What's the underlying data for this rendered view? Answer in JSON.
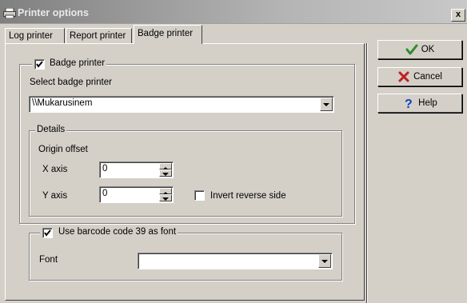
{
  "window": {
    "title": "Printer options",
    "close_label": "x"
  },
  "tabs": [
    {
      "label": "Log printer"
    },
    {
      "label": "Report printer"
    },
    {
      "label": "Badge printer",
      "active": true
    }
  ],
  "badge_section": {
    "checkbox_label": "Badge printer",
    "checked": true,
    "select_label": "Select badge printer",
    "selected_printer": "\\\\Mukarusinem"
  },
  "details": {
    "title": "Details",
    "origin_label": "Origin offset",
    "x_label": "X axis",
    "x_value": "0",
    "y_label": "Y axis",
    "y_value": "0",
    "invert_label": "Invert reverse side",
    "invert_checked": false
  },
  "barcode": {
    "checkbox_label": "Use barcode code 39 as font",
    "checked": true,
    "font_label": "Font",
    "font_value": ""
  },
  "buttons": {
    "ok": "OK",
    "cancel": "Cancel",
    "help": "Help"
  },
  "colors": {
    "ok_icon": "#2e8b2e",
    "cancel_icon": "#c02020",
    "help_icon": "#1040c0"
  }
}
